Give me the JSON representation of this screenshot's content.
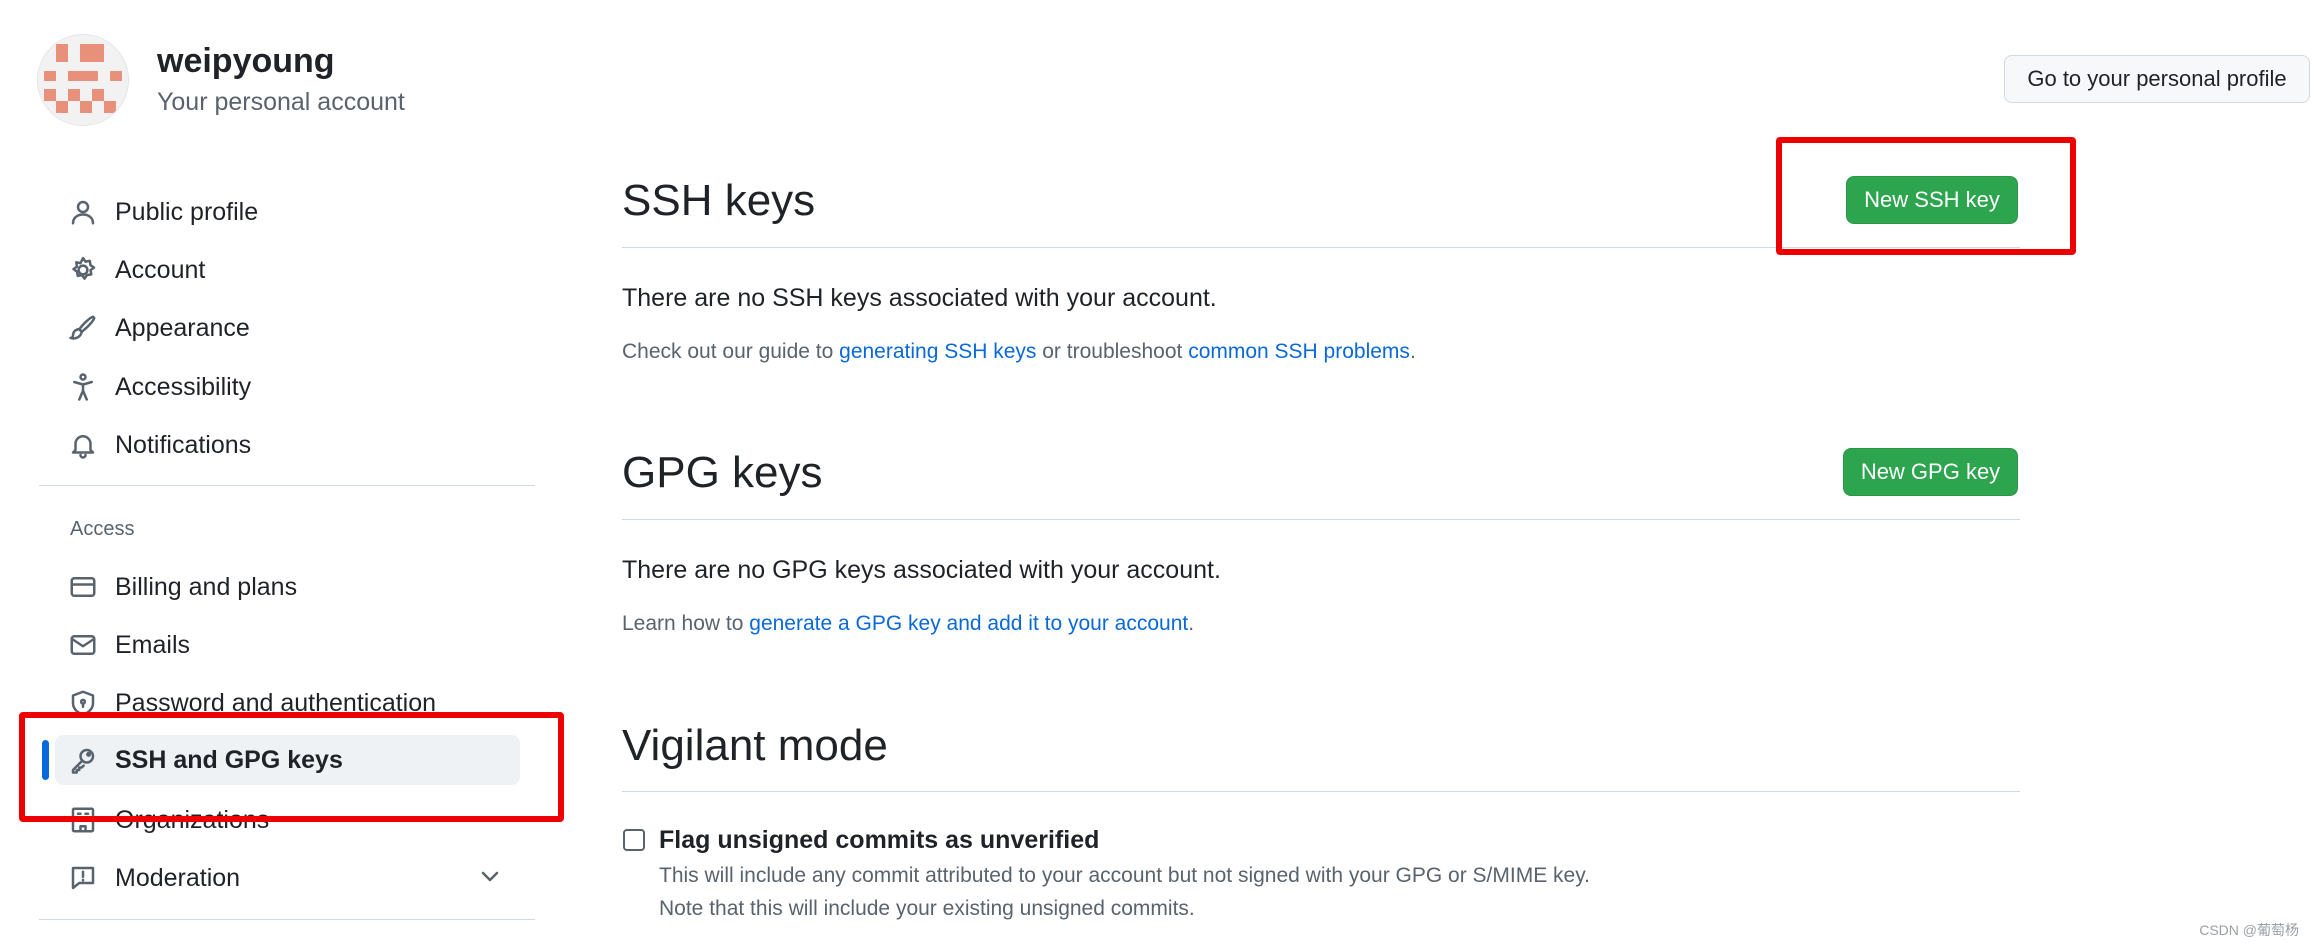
{
  "header": {
    "username": "weipyoung",
    "subtitle": "Your personal account",
    "profile_button": "Go to your personal profile"
  },
  "sidebar": {
    "items_top": [
      {
        "label": "Public profile",
        "icon": "person-icon"
      },
      {
        "label": "Account",
        "icon": "gear-icon"
      },
      {
        "label": "Appearance",
        "icon": "paintbrush-icon"
      },
      {
        "label": "Accessibility",
        "icon": "accessibility-icon"
      },
      {
        "label": "Notifications",
        "icon": "bell-icon"
      }
    ],
    "group_label": "Access",
    "items_access": [
      {
        "label": "Billing and plans",
        "icon": "credit-card-icon"
      },
      {
        "label": "Emails",
        "icon": "mail-icon"
      },
      {
        "label": "Password and authentication",
        "icon": "shield-lock-icon"
      },
      {
        "label": "SSH and GPG keys",
        "icon": "key-icon",
        "selected": true
      },
      {
        "label": "Organizations",
        "icon": "organization-icon"
      },
      {
        "label": "Moderation",
        "icon": "report-icon"
      }
    ]
  },
  "ssh": {
    "title": "SSH keys",
    "button": "New SSH key",
    "empty": "There are no SSH keys associated with your account.",
    "help_pre": "Check out our guide to ",
    "help_link1": "generating SSH keys",
    "help_mid": " or troubleshoot ",
    "help_link2": "common SSH problems",
    "help_post": "."
  },
  "gpg": {
    "title": "GPG keys",
    "button": "New GPG key",
    "empty": "There are no GPG keys associated with your account.",
    "help_pre": "Learn how to ",
    "help_link": "generate a GPG key and add it to your account",
    "help_post": "."
  },
  "vigilant": {
    "title": "Vigilant mode",
    "checkbox_label": "Flag unsigned commits as unverified",
    "checked": false,
    "note1": "This will include any commit attributed to your account but not signed with your GPG or S/MIME key.",
    "note2": "Note that this will include your existing unsigned commits."
  },
  "watermark": "CSDN @葡萄杨",
  "colors": {
    "accent_blue": "#0969da",
    "button_green": "#2da44e",
    "annotation_red": "#ef0000"
  }
}
